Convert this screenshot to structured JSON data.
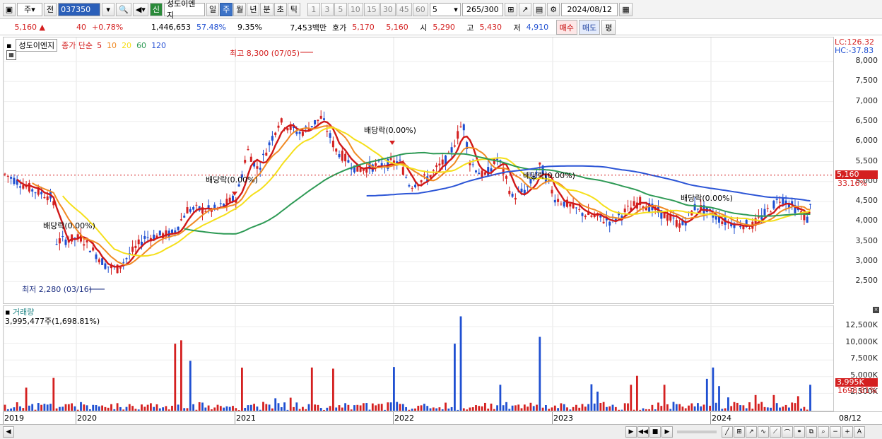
{
  "toolbar": {
    "period": "주",
    "prev": "전",
    "code": "037350",
    "badge_new": "신",
    "stock_name": "성도이엔지",
    "tabs": [
      "일",
      "주",
      "월",
      "년",
      "분",
      "초",
      "틱"
    ],
    "active_tab": "주",
    "intervals": [
      "1",
      "3",
      "5",
      "10",
      "15",
      "30",
      "45",
      "60"
    ],
    "interval_select": "5",
    "count": "265",
    "count_total": "/300",
    "date": "2024/08/12"
  },
  "quote": {
    "price": "5,160",
    "change": "40",
    "change_pct": "+0.78%",
    "volume": "1,446,653",
    "vol_ratio": "57.48%",
    "turnover": "9.35%",
    "amount": "7,453백만",
    "ask_label": "호가",
    "ask": "5,170",
    "bid": "5,160",
    "open_label": "시",
    "open": "5,290",
    "high_label": "고",
    "high": "5,430",
    "low_label": "저",
    "low": "4,910",
    "buy": "매수",
    "sell": "매도",
    "eval": "평"
  },
  "price_chart": {
    "stock_name": "성도이엔지",
    "legend_prefix": "종가 단순",
    "ma_periods": [
      "5",
      "10",
      "20",
      "60",
      "120"
    ],
    "ma_colors": [
      "#d01818",
      "#f08a24",
      "#f5df1a",
      "#2e9a55",
      "#2c55d6"
    ],
    "lc": "LC:126.32",
    "hc": "HC:-37.83",
    "max_label": "최고 8,300 (07/05)",
    "min_label": "최저 2,280 (03/16)",
    "dividend_label": "배당락(0.00%)",
    "price_tag": "5,160",
    "price_tag_pct": "33.16%",
    "yticks": [
      "8,000",
      "7,500",
      "7,000",
      "6,500",
      "6,000",
      "5,500",
      "5,000",
      "4,500",
      "4,000",
      "3,500",
      "3,000",
      "2,500"
    ]
  },
  "volume_chart": {
    "title": "거래량",
    "value": "3,995,477주(1,698.81%)",
    "tag": "3,995K",
    "tag_pct": "1698.81%",
    "yticks": [
      "12,500K",
      "10,000K",
      "7,500K",
      "5,000K",
      "2,500K"
    ]
  },
  "xaxis": {
    "labels": [
      "2019",
      "2020",
      "2021",
      "2022",
      "2023",
      "2024"
    ],
    "right_label": "08/12"
  }
}
